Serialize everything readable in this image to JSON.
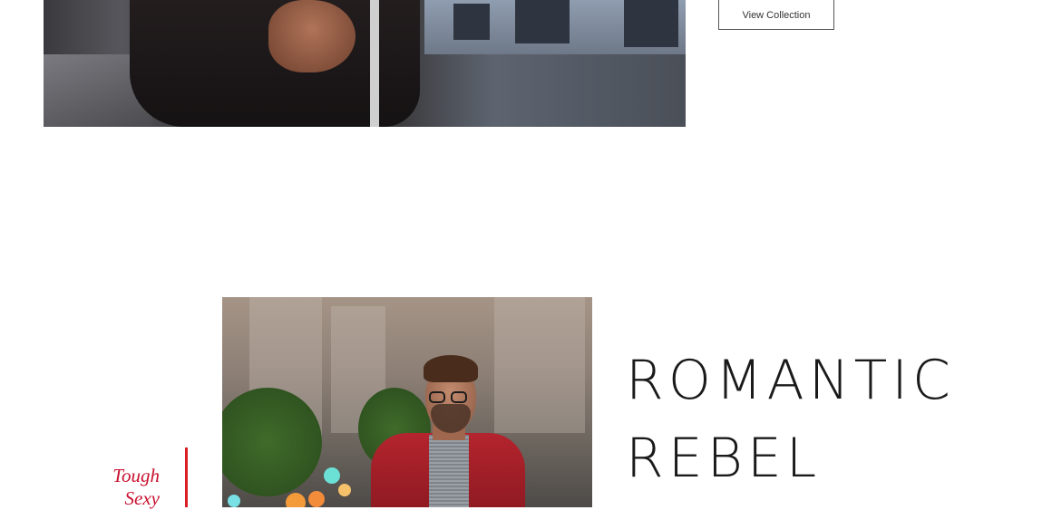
{
  "collection_button": {
    "label": "View Collection"
  },
  "feature": {
    "headline_line1": "ROMANTIC",
    "headline_line2": "REBEL",
    "tagline": [
      "Tough",
      "Sexy"
    ]
  },
  "colors": {
    "accent_red": "#c8102e",
    "text_dark": "#1a1a1a",
    "button_border": "#555555"
  },
  "images": {
    "top_photo": "man-in-dark-jacket-street-photo",
    "bottom_photo": "man-in-red-blazer-city-photo"
  }
}
